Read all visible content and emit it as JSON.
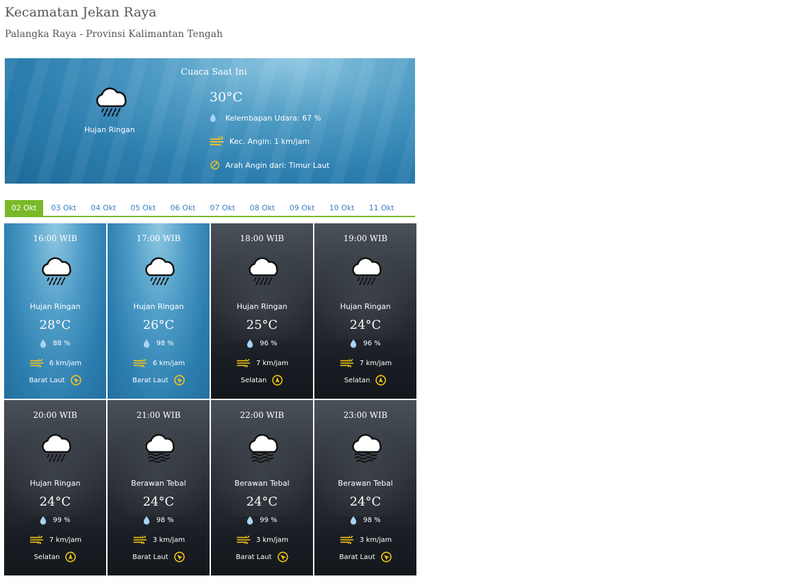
{
  "header": {
    "title": "Kecamatan Jekan Raya",
    "subtitle": "Palangka Raya - Provinsi Kalimantan Tengah"
  },
  "current": {
    "heading": "Cuaca Saat Ini",
    "condition": "Hujan Ringan",
    "condition_icon": "rain-cloud-icon",
    "temperature": "30°C",
    "humidity": "Kelembapan Udara: 67 %",
    "wind_speed": "Kec. Angin: 1 km/jam",
    "wind_direction": "Arah Angin dari: Timur Laut"
  },
  "tabs": [
    {
      "label": "02 Okt",
      "active": true
    },
    {
      "label": "03 Okt",
      "active": false
    },
    {
      "label": "04 Okt",
      "active": false
    },
    {
      "label": "05 Okt",
      "active": false
    },
    {
      "label": "06 Okt",
      "active": false
    },
    {
      "label": "07 Okt",
      "active": false
    },
    {
      "label": "08 Okt",
      "active": false
    },
    {
      "label": "09 Okt",
      "active": false
    },
    {
      "label": "10 Okt",
      "active": false
    },
    {
      "label": "11 Okt",
      "active": false
    }
  ],
  "forecast": [
    {
      "time": "16:00 WIB",
      "condition": "Hujan Ringan",
      "icon": "rain-cloud-icon",
      "temp": "28°C",
      "humidity": "88 %",
      "wind": "6 km/jam",
      "direction": "Barat Laut",
      "theme": "day"
    },
    {
      "time": "17:00 WIB",
      "condition": "Hujan Ringan",
      "icon": "rain-cloud-icon",
      "temp": "26°C",
      "humidity": "98 %",
      "wind": "6 km/jam",
      "direction": "Barat Laut",
      "theme": "day"
    },
    {
      "time": "18:00 WIB",
      "condition": "Hujan Ringan",
      "icon": "rain-cloud-icon",
      "temp": "25°C",
      "humidity": "96 %",
      "wind": "7 km/jam",
      "direction": "Selatan",
      "theme": "night"
    },
    {
      "time": "19:00 WIB",
      "condition": "Hujan Ringan",
      "icon": "rain-cloud-icon",
      "temp": "24°C",
      "humidity": "96 %",
      "wind": "7 km/jam",
      "direction": "Selatan",
      "theme": "night"
    },
    {
      "time": "20:00 WIB",
      "condition": "Hujan Ringan",
      "icon": "rain-cloud-icon",
      "temp": "24°C",
      "humidity": "99 %",
      "wind": "7 km/jam",
      "direction": "Selatan",
      "theme": "night"
    },
    {
      "time": "21:00 WIB",
      "condition": "Berawan Tebal",
      "icon": "fog-cloud-icon",
      "temp": "24°C",
      "humidity": "98 %",
      "wind": "3 km/jam",
      "direction": "Barat Laut",
      "theme": "night"
    },
    {
      "time": "22:00 WIB",
      "condition": "Berawan Tebal",
      "icon": "fog-cloud-icon",
      "temp": "24°C",
      "humidity": "99 %",
      "wind": "3 km/jam",
      "direction": "Barat Laut",
      "theme": "night"
    },
    {
      "time": "23:00 WIB",
      "condition": "Berawan Tebal",
      "icon": "fog-cloud-icon",
      "temp": "24°C",
      "humidity": "98 %",
      "wind": "3 km/jam",
      "direction": "Barat Laut",
      "theme": "night"
    }
  ],
  "colors": {
    "accent_green": "#7ab928",
    "tab_text_blue": "#3f7fc4",
    "wind_icon_yellow": "#f5c518",
    "drop_blue": "#a8d4f5"
  }
}
